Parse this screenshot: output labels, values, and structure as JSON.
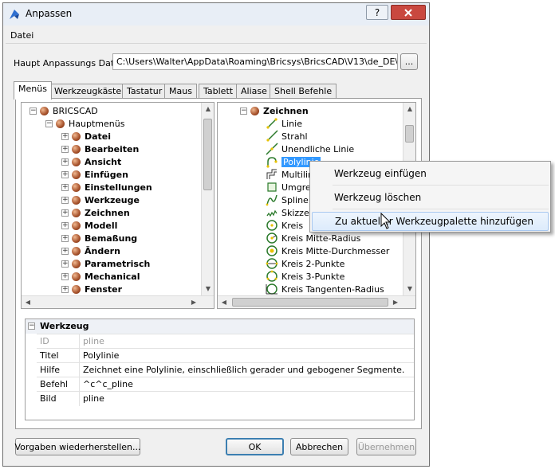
{
  "window": {
    "title": "Anpassen",
    "help_btn": "?",
    "close_btn": "X"
  },
  "menubar": {
    "file_menu": "Datei"
  },
  "main_file": {
    "label": "Haupt Anpassungs Datei:",
    "path": "C:\\Users\\Walter\\AppData\\Roaming\\Bricsys\\BricsCAD\\V13\\de_DE\\Suppor",
    "browse_btn": "..."
  },
  "tabs": [
    {
      "label": "Menüs"
    },
    {
      "label": "Werkzeugkästen"
    },
    {
      "label": "Tastatur"
    },
    {
      "label": "Maus"
    },
    {
      "label": "Tablett"
    },
    {
      "label": "Aliase"
    },
    {
      "label": "Shell Befehle"
    }
  ],
  "left_tree": {
    "root": "BRICSCAD",
    "child": "Hauptmenüs",
    "items": [
      "Datei",
      "Bearbeiten",
      "Ansicht",
      "Einfügen",
      "Einstellungen",
      "Werkzeuge",
      "Zeichnen",
      "Modell",
      "Bemaßung",
      "Ändern",
      "Parametrisch",
      "Mechanical",
      "Fenster"
    ]
  },
  "right_tree": {
    "root": "Zeichnen",
    "items": [
      {
        "label": "Linie",
        "icon": "line-icon"
      },
      {
        "label": "Strahl",
        "icon": "ray-icon"
      },
      {
        "label": "Unendliche Linie",
        "icon": "xline-icon"
      },
      {
        "label": "Polylinie",
        "icon": "polyline-icon"
      },
      {
        "label": "Multilin",
        "icon": "multiline-icon"
      },
      {
        "label": "Umgre",
        "icon": "boundary-icon"
      },
      {
        "label": "Spline",
        "icon": "spline-icon"
      },
      {
        "label": "Skizze",
        "icon": "sketch-icon"
      },
      {
        "label": "Kreis",
        "icon": "circle-icon"
      },
      {
        "label": "Kreis Mitte-Radius",
        "icon": "circle-radius-icon"
      },
      {
        "label": "Kreis Mitte-Durchmesser",
        "icon": "circle-diameter-icon"
      },
      {
        "label": "Kreis 2-Punkte",
        "icon": "circle-2p-icon"
      },
      {
        "label": "Kreis 3-Punkte",
        "icon": "circle-3p-icon"
      },
      {
        "label": "Kreis Tangenten-Radius",
        "icon": "circle-ttr-icon"
      }
    ]
  },
  "properties": {
    "header": "Werkzeug",
    "rows": [
      {
        "key": "ID",
        "value": "pline"
      },
      {
        "key": "Titel",
        "value": "Polylinie"
      },
      {
        "key": "Hilfe",
        "value": "Zeichnet eine Polylinie, einschließlich gerader und gebogener Segmente."
      },
      {
        "key": "Befehl",
        "value": "^c^c_pline"
      },
      {
        "key": "Bild",
        "value": "pline"
      }
    ]
  },
  "context_menu": {
    "items": [
      "Werkzeug einfügen",
      "Werkzeug löschen",
      "Zu aktueller Werkzeugpalette hinzufügen"
    ]
  },
  "buttons": {
    "restore": "Vorgaben wiederherstellen...",
    "ok": "OK",
    "cancel": "Abbrechen",
    "apply": "Übernehmen"
  },
  "colors": {
    "selection": "#3399ff",
    "ball": "#a5502a",
    "disabled_text": "#9a9a9a"
  }
}
